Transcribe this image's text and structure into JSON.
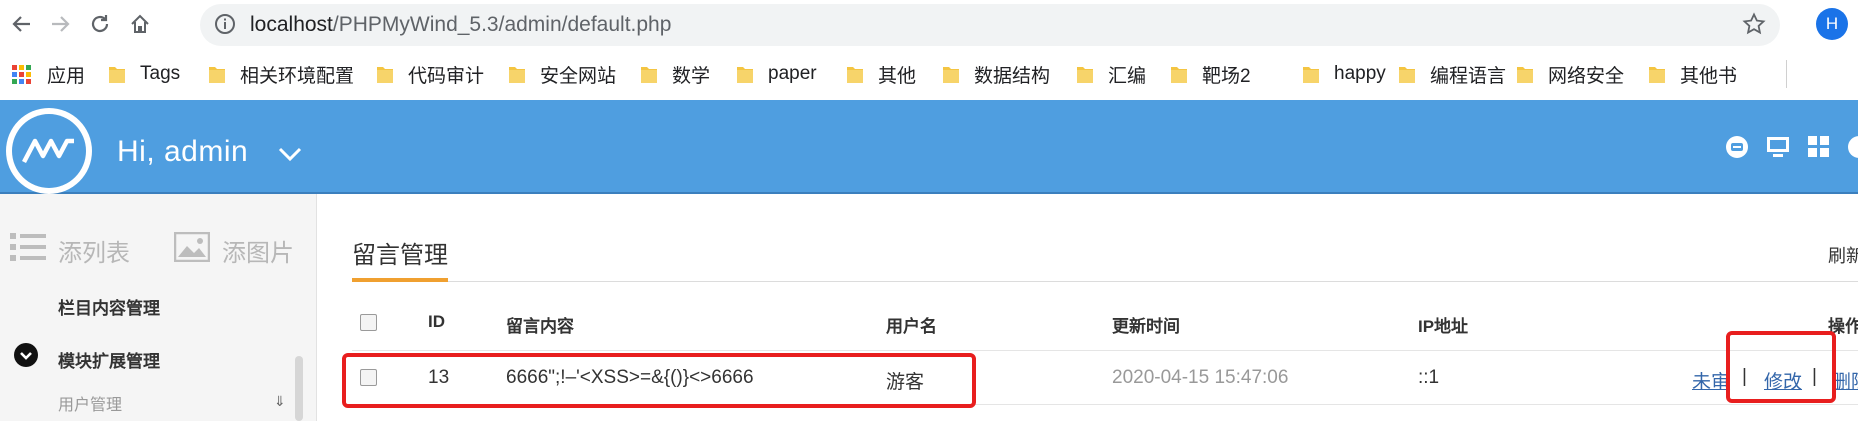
{
  "browser": {
    "url_host": "localhost",
    "url_path": "/PHPMyWind_5.3/admin/default.php",
    "profile_initial": "H",
    "bookmarks": [
      "应用",
      "Tags",
      "相关环境配置",
      "代码审计",
      "安全网站",
      "数学",
      "paper",
      "其他",
      "数据结构",
      "汇编",
      "靶场2",
      "happy",
      "编程语言",
      "网络安全",
      "其他书"
    ],
    "icons": [
      "back-icon",
      "forward-icon",
      "reload-icon",
      "home-icon",
      "info-icon",
      "star-icon",
      "apps-icon",
      "folder-icon"
    ]
  },
  "header": {
    "greeting": "Hi, admin",
    "colors": {
      "bar": "#4f9ee0",
      "accent": "#f0a030",
      "annotation": "#e81e1e"
    }
  },
  "sidebar": {
    "tool_list": "添列表",
    "tool_image": "添图片",
    "item_column": "栏目内容管理",
    "item_module": "模块扩展管理",
    "sub_user": "用户管理"
  },
  "main": {
    "title": "留言管理",
    "refresh": "刷新",
    "columns": [
      "ID",
      "留言内容",
      "用户名",
      "更新时间",
      "IP地址",
      "操作"
    ],
    "rows": [
      {
        "id": "13",
        "content": "6666\";!–'<XSS>=&{()}<>6666",
        "user": "游客",
        "time": "2020-04-15 15:47:06",
        "ip": "::1",
        "op_review": "未审",
        "op_edit": "修改",
        "op_delete": "删除"
      }
    ]
  }
}
